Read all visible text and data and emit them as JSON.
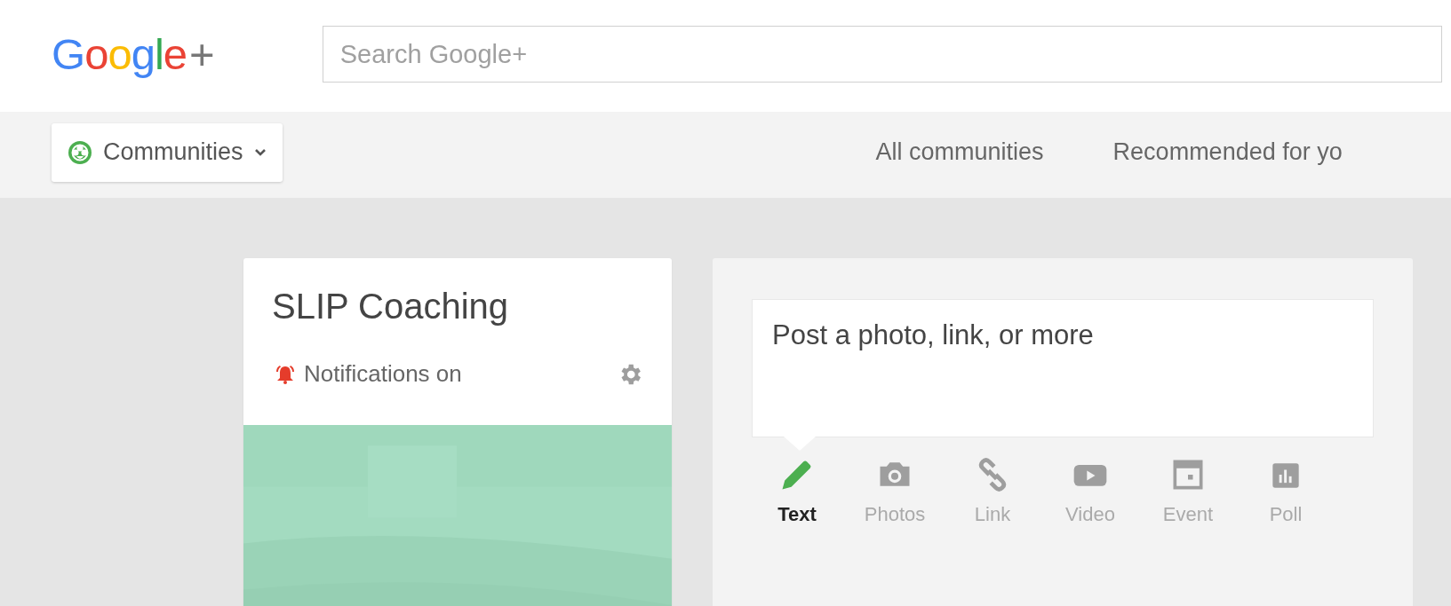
{
  "header": {
    "logo": {
      "word": "Google",
      "plus": "+"
    },
    "search": {
      "placeholder": "Search Google+"
    }
  },
  "subnav": {
    "menu": {
      "label": "Communities"
    },
    "links": [
      {
        "label": "All communities"
      },
      {
        "label": "Recommended for yo"
      }
    ]
  },
  "community": {
    "name": "SLIP Coaching",
    "notifications": {
      "label": "Notifications on",
      "on": true
    }
  },
  "composer": {
    "placeholder": "Post a photo, link, or more",
    "tabs": [
      {
        "kind": "text",
        "label": "Text",
        "selected": true
      },
      {
        "kind": "photos",
        "label": "Photos",
        "selected": false
      },
      {
        "kind": "link",
        "label": "Link",
        "selected": false
      },
      {
        "kind": "video",
        "label": "Video",
        "selected": false
      },
      {
        "kind": "event",
        "label": "Event",
        "selected": false
      },
      {
        "kind": "poll",
        "label": "Poll",
        "selected": false
      }
    ]
  }
}
